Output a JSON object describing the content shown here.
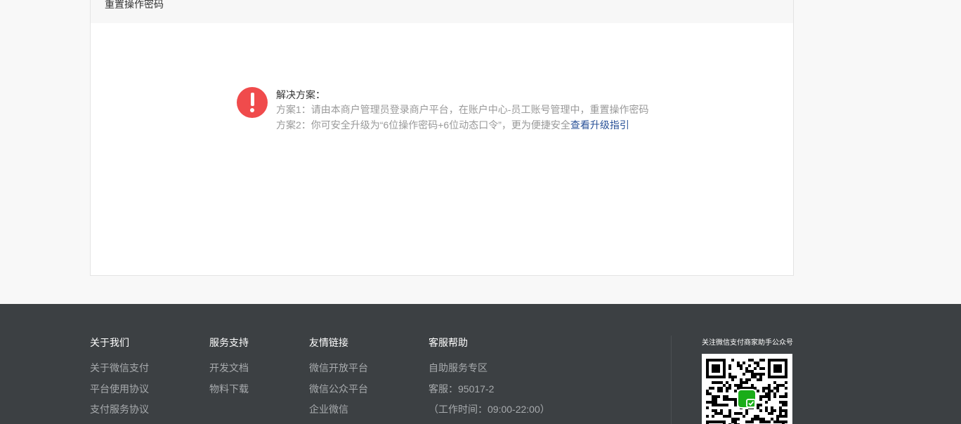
{
  "panel": {
    "title": "重置操作密码"
  },
  "solution": {
    "icon": "alert-icon",
    "icon_color": "#f04b4c",
    "title": "解决方案：",
    "line1": "方案1：请由本商户管理员登录商户平台，在账户中心-员工账号管理中，重置操作密码",
    "line2_prefix": "方案2：你可安全升级为“6位操作密码+6位动态口令”，更为便捷安全",
    "line2_link": "查看升级指引",
    "link_color": "#2a5298"
  },
  "footer": {
    "background": "#3c4043",
    "columns": [
      {
        "title": "关于我们",
        "items": [
          "关于微信支付",
          "平台使用协议",
          "支付服务协议"
        ]
      },
      {
        "title": "服务支持",
        "items": [
          "开发文档",
          "物料下载"
        ]
      },
      {
        "title": "友情链接",
        "items": [
          "微信开放平台",
          "微信公众平台",
          "企业微信"
        ]
      },
      {
        "title": "客服帮助",
        "items": [
          "自助服务专区",
          "客服：95017-2",
          "（工作时间：09:00-22:00）"
        ]
      }
    ],
    "qr_caption": "关注微信支付商家助手公众号",
    "qr_icon": "wechat-pay-logo-icon"
  }
}
